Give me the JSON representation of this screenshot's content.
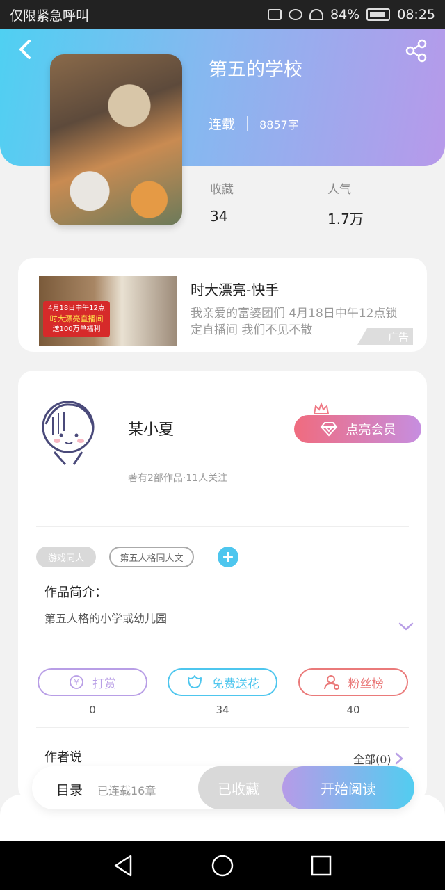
{
  "status_bar": {
    "carrier": "仅限紧急呼叫",
    "battery": "84%",
    "time": "08:25"
  },
  "book": {
    "title": "第五的学校",
    "status": "连载",
    "word_count": "8857字",
    "stats": [
      {
        "label": "收藏",
        "value": "34"
      },
      {
        "label": "人气",
        "value": "1.7万"
      }
    ]
  },
  "ad": {
    "title": "时大漂亮-快手",
    "description": "我亲爱的富婆团们 4月18日中午12点锁定直播间 我们不见不散",
    "tag": "广告",
    "banner_line1": "4月18日中午12点",
    "banner_line2": "时大漂亮直播间",
    "banner_line3": "送100万单福利"
  },
  "author": {
    "name": "某小夏",
    "meta": "著有2部作品·11人关注",
    "vip_label": "点亮会员"
  },
  "tags": [
    "游戏同人",
    "第五人格同人文"
  ],
  "intro": {
    "label": "作品简介：",
    "text": "第五人格的小学或幼儿园"
  },
  "actions": [
    {
      "label": "打赏",
      "count": "0"
    },
    {
      "label": "免费送花",
      "count": "34"
    },
    {
      "label": "粉丝榜",
      "count": "40"
    }
  ],
  "author_say": {
    "label": "作者说",
    "all_link": "全部(0)"
  },
  "bottom_bar": {
    "toc_label": "目录",
    "toc_meta": "已连载16章",
    "collected_label": "已收藏",
    "read_label": "开始阅读"
  },
  "colors": {
    "accent_blue": "#4ec6ee",
    "accent_purple": "#b69be8",
    "accent_red": "#ea7a7a"
  }
}
